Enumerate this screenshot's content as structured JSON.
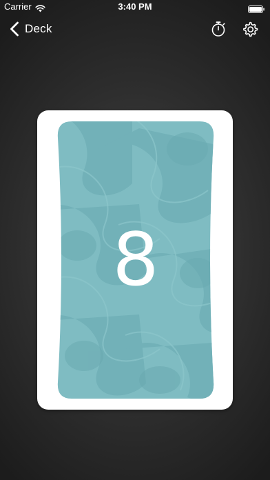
{
  "status_bar": {
    "carrier": "Carrier",
    "time": "3:40 PM",
    "wifi_icon": "wifi-icon",
    "battery_icon": "battery-icon"
  },
  "nav": {
    "back_label": "Deck",
    "back_icon": "chevron-left-icon",
    "timer_icon": "timer-icon",
    "settings_icon": "gear-icon"
  },
  "card": {
    "value": "8",
    "face_color": "#7fbcc2",
    "pattern_color": "#6aa9b0",
    "border_color": "#ffffff"
  },
  "colors": {
    "background": "#2e2e2e",
    "text": "#ffffff"
  }
}
